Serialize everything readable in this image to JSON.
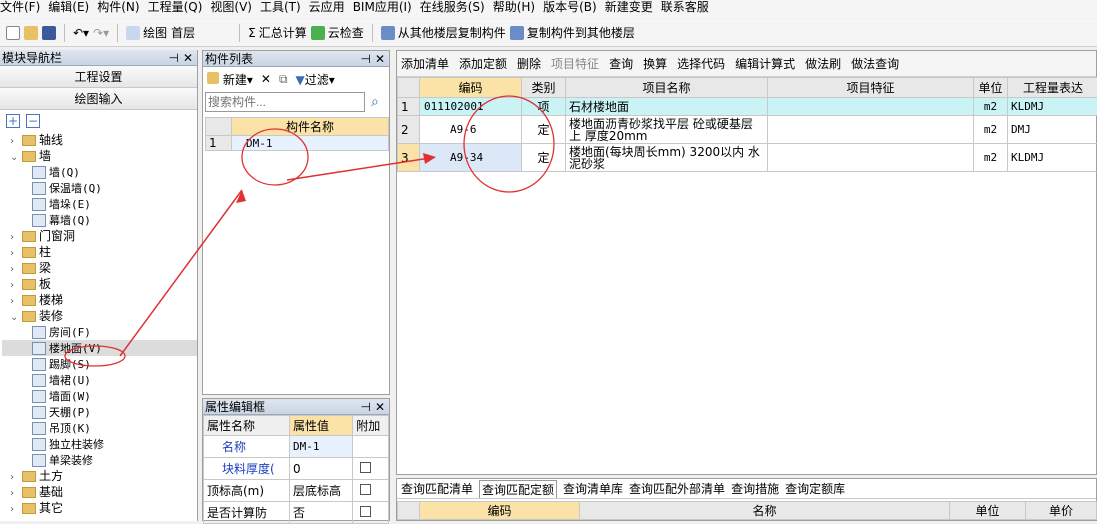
{
  "menu": [
    "文件(F)",
    "编辑(E)",
    "构件(N)",
    "工程量(Q)",
    "视图(V)",
    "工具(T)",
    "云应用",
    "BIM应用(I)",
    "在线服务(S)",
    "帮助(H)",
    "版本号(B)",
    "新建变更",
    "联系客服"
  ],
  "toolbar": {
    "draw_label": "绘图",
    "floor_value": "首层",
    "sum_label": "汇总计算",
    "cloud_check_label": "云检查",
    "copy_from_label": "从其他楼层复制构件",
    "copy_to_label": "复制构件到其他楼层"
  },
  "nav": {
    "title": "模块导航栏",
    "btn_project": "工程设置",
    "btn_draw": "绘图输入",
    "tree": [
      {
        "label": "轴线",
        "level": 0,
        "type": "folder",
        "expanded": false
      },
      {
        "label": "墙",
        "level": 0,
        "type": "folder",
        "expanded": true
      },
      {
        "label": "墙(Q)",
        "level": 1,
        "type": "leaf"
      },
      {
        "label": "保温墙(Q)",
        "level": 1,
        "type": "leaf"
      },
      {
        "label": "墙垛(E)",
        "level": 1,
        "type": "leaf"
      },
      {
        "label": "幕墙(Q)",
        "level": 1,
        "type": "leaf"
      },
      {
        "label": "门窗洞",
        "level": 0,
        "type": "folder",
        "expanded": false
      },
      {
        "label": "柱",
        "level": 0,
        "type": "folder",
        "expanded": false
      },
      {
        "label": "梁",
        "level": 0,
        "type": "folder",
        "expanded": false
      },
      {
        "label": "板",
        "level": 0,
        "type": "folder",
        "expanded": false
      },
      {
        "label": "楼梯",
        "level": 0,
        "type": "folder",
        "expanded": false
      },
      {
        "label": "装修",
        "level": 0,
        "type": "folder",
        "expanded": true
      },
      {
        "label": "房间(F)",
        "level": 1,
        "type": "leaf"
      },
      {
        "label": "楼地面(V)",
        "level": 1,
        "type": "leaf",
        "selected": true
      },
      {
        "label": "踢脚(S)",
        "level": 1,
        "type": "leaf"
      },
      {
        "label": "墙裙(U)",
        "level": 1,
        "type": "leaf"
      },
      {
        "label": "墙面(W)",
        "level": 1,
        "type": "leaf"
      },
      {
        "label": "天棚(P)",
        "level": 1,
        "type": "leaf"
      },
      {
        "label": "吊顶(K)",
        "level": 1,
        "type": "leaf"
      },
      {
        "label": "独立柱装修",
        "level": 1,
        "type": "leaf"
      },
      {
        "label": "单梁装修",
        "level": 1,
        "type": "leaf"
      },
      {
        "label": "土方",
        "level": 0,
        "type": "folder",
        "expanded": false
      },
      {
        "label": "基础",
        "level": 0,
        "type": "folder",
        "expanded": false
      },
      {
        "label": "其它",
        "level": 0,
        "type": "folder",
        "expanded": false
      }
    ]
  },
  "complist": {
    "title": "构件列表",
    "new_label": "新建",
    "filter_label": "过滤",
    "search_placeholder": "搜索构件...",
    "col_name": "构件名称",
    "rows": [
      {
        "no": "1",
        "name": "DM-1"
      }
    ]
  },
  "props": {
    "title": "属性编辑框",
    "col_name": "属性名称",
    "col_value": "属性值",
    "col_extra": "附加",
    "rows": [
      {
        "name": "名称",
        "value": "DM-1",
        "blue": true
      },
      {
        "name": "块料厚度(",
        "value": "0",
        "blue": true
      },
      {
        "name": "顶标高(m)",
        "value": "层底标高",
        "blue": false
      },
      {
        "name": "是否计算防",
        "value": "否",
        "blue": false
      }
    ]
  },
  "main": {
    "toolbar": [
      "添加清单",
      "添加定额",
      "删除",
      "项目特征",
      "查询",
      "换算",
      "选择代码",
      "编辑计算式",
      "做法刷",
      "做法查询"
    ],
    "cols": [
      "编码",
      "类别",
      "项目名称",
      "项目特征",
      "单位",
      "工程量表达"
    ],
    "rows": [
      {
        "no": "1",
        "code": "011102001",
        "type": "项",
        "name": "石材楼地面",
        "feature": "",
        "unit": "m2",
        "expr": "KLDMJ"
      },
      {
        "no": "2",
        "code": "A9-6",
        "type": "定",
        "name": "楼地面沥青砂浆找平层 砼或硬基层上 厚度20mm",
        "feature": "",
        "unit": "m2",
        "expr": "DMJ"
      },
      {
        "no": "3",
        "code": "A9-34",
        "type": "定",
        "name": "楼地面(每块周长mm) 3200以内 水泥砂浆",
        "feature": "",
        "unit": "m2",
        "expr": "KLDMJ"
      }
    ]
  },
  "bottom": {
    "tabs": [
      "查询匹配清单",
      "查询匹配定额",
      "查询清单库",
      "查询匹配外部清单",
      "查询措施",
      "查询定额库"
    ],
    "active_tab": 1,
    "cols": [
      "编码",
      "名称",
      "单位",
      "单价"
    ]
  }
}
